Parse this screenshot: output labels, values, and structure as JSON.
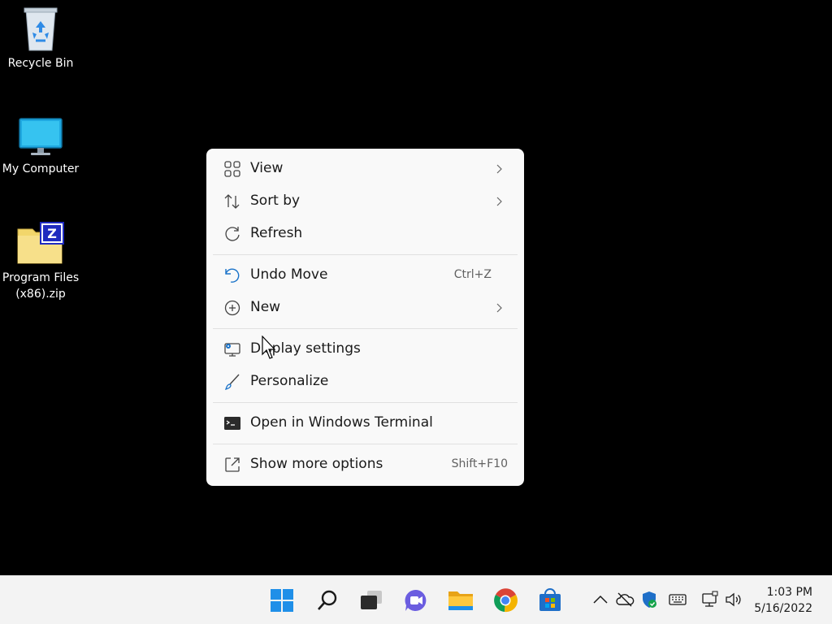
{
  "desktop": {
    "icons": [
      {
        "label": "Recycle Bin",
        "icon": "recycle-bin-icon"
      },
      {
        "label": "My Computer",
        "icon": "monitor-icon"
      },
      {
        "label_line1": "Program Files",
        "label_line2": "(x86).zip",
        "icon": "zip-folder-icon"
      }
    ]
  },
  "context_menu": {
    "items": [
      {
        "label": "View",
        "icon": "grid-view-icon",
        "submenu": true
      },
      {
        "label": "Sort by",
        "icon": "sort-icon",
        "submenu": true
      },
      {
        "label": "Refresh",
        "icon": "refresh-icon"
      },
      {
        "label": "Undo Move",
        "icon": "undo-icon",
        "shortcut": "Ctrl+Z"
      },
      {
        "label": "New",
        "icon": "plus-circle-icon",
        "submenu": true
      },
      {
        "label": "Display settings",
        "icon": "display-settings-icon"
      },
      {
        "label": "Personalize",
        "icon": "brush-icon"
      },
      {
        "label": "Open in Windows Terminal",
        "icon": "terminal-icon"
      },
      {
        "label": "Show more options",
        "icon": "expand-icon",
        "shortcut": "Shift+F10"
      }
    ]
  },
  "taskbar": {
    "apps": [
      "start-icon",
      "search-icon",
      "task-view-icon",
      "chat-icon",
      "file-explorer-icon",
      "chrome-icon",
      "store-icon"
    ],
    "tray": [
      "chevron-up-icon",
      "onedrive-icon",
      "security-icon",
      "keyboard-icon",
      "network-icon",
      "volume-icon"
    ],
    "clock": {
      "time": "1:03 PM",
      "date": "5/16/2022"
    }
  },
  "colors": {
    "desktop_bg": "#000000",
    "menu_bg": "#f9f9f9",
    "accent": "#0078d4",
    "taskbar_bg": "#f3f3f3"
  }
}
